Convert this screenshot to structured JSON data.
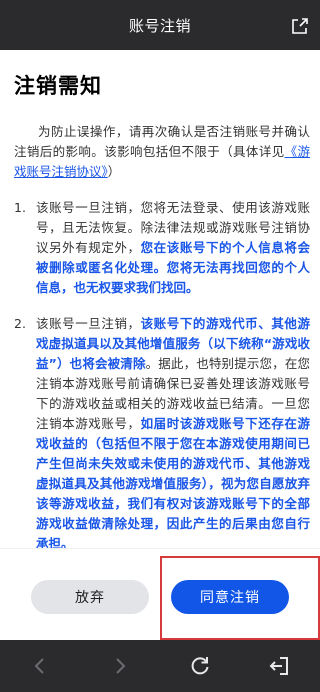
{
  "header": {
    "title": "账号注销",
    "share_icon": "share-icon"
  },
  "content": {
    "heading": "注销需知",
    "intro_text": "为防止误操作，请再次确认是否注销账号并确认注销后的影响。该影响包括但不限于（具体详见",
    "intro_link": "《游戏账号注销协议》",
    "intro_end": "）",
    "items": [
      {
        "num": "1.",
        "p1": "该账号一旦注销，您将无法登录、使用该游戏账号，且无法恢复。除法律法规或游戏账号注销协议另外有规定外，",
        "p2": "您在该账号下的个人信息将会被删除或匿名化处理。您将无法再找回您的个人信息，也无权要求我们找回。"
      },
      {
        "num": "2.",
        "p1": "该账号一旦注销，",
        "p2": "该账号下的游戏代币、其他游戏虚拟道具以及其他增值服务（以下统称“游戏收益”）也将会被清除",
        "p3": "。据此，也特别提示您，在您注销本游戏账号前请确保已妥善处理该游戏账号下的游戏收益或相关的游戏收益已结清。一旦您注销本游戏账号，",
        "p4": "如届时该游戏账号下还存在游戏收益的（包括但不限于您在本游戏使用期间已产生但尚未失效或未使用的游戏代币、其他游戏虚拟道具及其他游戏增值服务），视为您自愿放弃该等游戏收益，我们有权对该游戏账号下的全部游戏收益做清除处理，因此产生的后果由您自行承担。"
      }
    ]
  },
  "footer": {
    "cancel_label": "放弃",
    "agree_label": "同意注销"
  },
  "nav": {
    "back_icon": "back-arrow-icon",
    "forward_icon": "forward-arrow-icon",
    "refresh_icon": "refresh-icon",
    "exit_icon": "exit-icon"
  },
  "colors": {
    "accent": "#1256e8",
    "highlight_border": "#d73a3a",
    "bar_bg": "#2b2b2e"
  }
}
